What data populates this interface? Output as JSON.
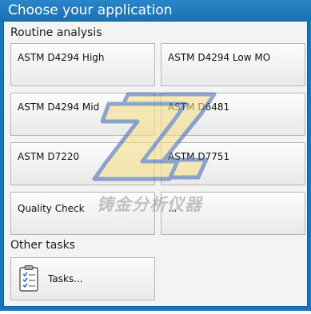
{
  "window": {
    "title": "Choose your application"
  },
  "routine": {
    "label": "Routine analysis",
    "tiles": [
      {
        "label": "ASTM D4294 High"
      },
      {
        "label": "ASTM D4294 Low MO"
      },
      {
        "label": "ASTM D4294 Mid"
      },
      {
        "label": "ASTM D6481"
      },
      {
        "label": "ASTM D7220"
      },
      {
        "label": "ASTM D7751"
      },
      {
        "label": "Quality Check"
      },
      {
        "label": "..."
      }
    ]
  },
  "other": {
    "label": "Other tasks",
    "tasks_label": "Tasks..."
  },
  "watermark": {
    "text": "铸金分析仪器"
  },
  "colors": {
    "titlebar": "#1b75b8",
    "background": "#f3f3f3",
    "tile_border": "#b6b6b6",
    "watermark_blue": "#4a6fb3",
    "watermark_yellow": "#f5e08a"
  }
}
